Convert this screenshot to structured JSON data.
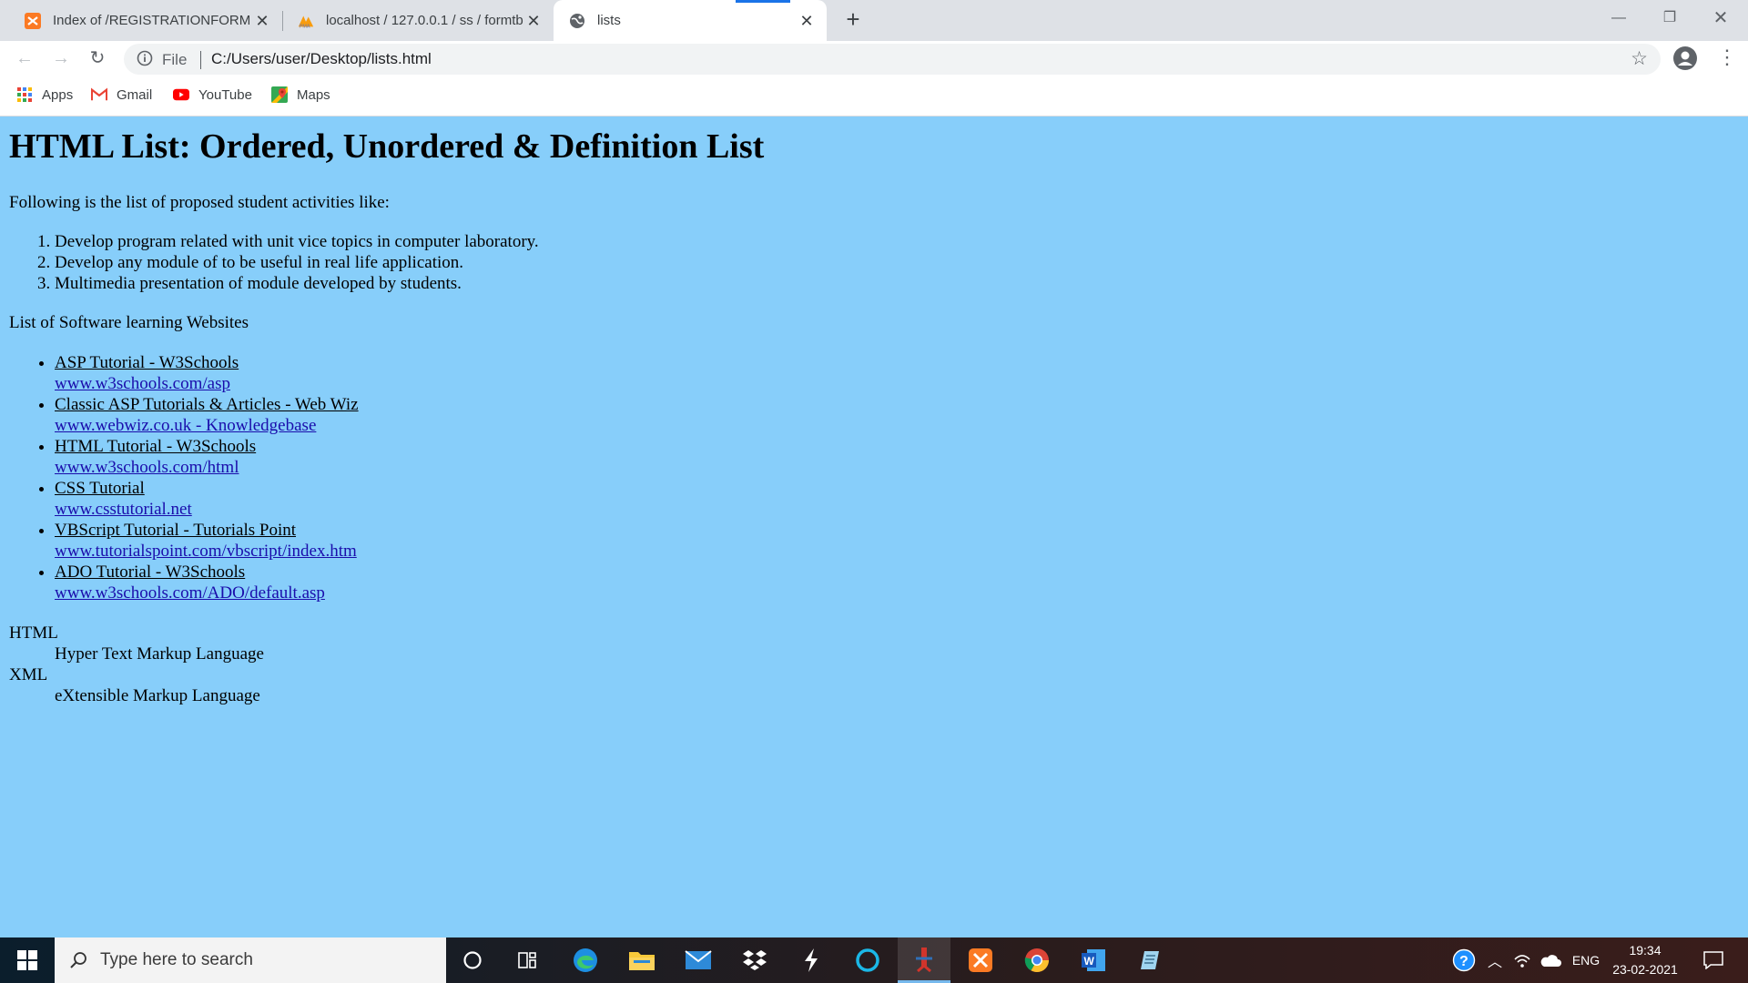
{
  "browser": {
    "tabs": [
      {
        "title": "Index of /REGISTRATIONFORM",
        "icon": "xampp-icon"
      },
      {
        "title": "localhost / 127.0.0.1 / ss / formtb",
        "icon": "phpmyadmin-icon"
      },
      {
        "title": "lists",
        "icon": "globe-icon"
      }
    ],
    "active_tab": 2,
    "address": {
      "protocol_label": "File",
      "url": "C:/Users/user/Desktop/lists.html"
    },
    "bookmarks": [
      {
        "label": "Apps",
        "icon": "apps-grid-icon"
      },
      {
        "label": "Gmail",
        "icon": "gmail-icon"
      },
      {
        "label": "YouTube",
        "icon": "youtube-icon"
      },
      {
        "label": "Maps",
        "icon": "maps-icon"
      }
    ]
  },
  "page": {
    "background": "#87cefa",
    "heading": "HTML List: Ordered, Unordered & Definition List",
    "intro": "Following is the list of proposed student activities like:",
    "ordered_items": [
      "Develop program related with unit vice topics in computer laboratory.",
      "Develop any module of to be useful in real life application.",
      "Multimedia presentation of module developed by students."
    ],
    "websites_intro": "List of Software learning Websites",
    "websites": [
      {
        "title": "ASP Tutorial - W3Schools",
        "link": "www.w3schools.com/asp"
      },
      {
        "title": "Classic ASP Tutorials & Articles - Web Wiz",
        "link": "www.webwiz.co.uk - Knowledgebase"
      },
      {
        "title": "HTML Tutorial - W3Schools",
        "link": "www.w3schools.com/html"
      },
      {
        "title": "CSS Tutorial",
        "link": "www.csstutorial.net"
      },
      {
        "title": "VBScript Tutorial - Tutorials Point",
        "link": "www.tutorialspoint.com/vbscript/index.htm"
      },
      {
        "title": "ADO Tutorial - W3Schools",
        "link": "www.w3schools.com/ADO/default.asp"
      }
    ],
    "definitions": [
      {
        "term": "HTML",
        "desc": "Hyper Text Markup Language"
      },
      {
        "term": "XML",
        "desc": "eXtensible Markup Language"
      }
    ]
  },
  "taskbar": {
    "search_placeholder": "Type here to search",
    "language": "ENG",
    "time": "19:34",
    "date": "23-02-2021"
  }
}
